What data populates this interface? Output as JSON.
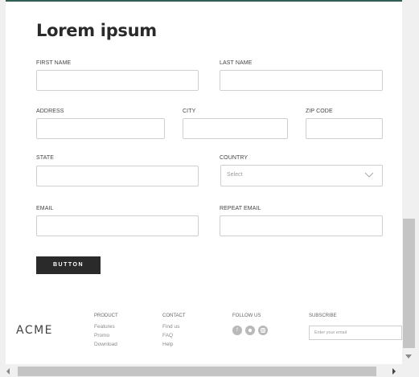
{
  "page": {
    "title": "Lorem ipsum"
  },
  "form": {
    "first_name_label": "FIRST NAME",
    "last_name_label": "LAST NAME",
    "address_label": "ADDRESS",
    "city_label": "CITY",
    "zip_label": "ZIP CODE",
    "state_label": "STATE",
    "country_label": "COUNTRY",
    "country_placeholder": "Select",
    "email_label": "EMAIL",
    "repeat_email_label": "REPEAT EMAIL",
    "submit_label": "BUTTON"
  },
  "footer": {
    "logo": "ACME",
    "product_heading": "PRODUCT",
    "product_links": [
      "Features",
      "Promo",
      "Download"
    ],
    "contact_heading": "CONTACT",
    "contact_links": [
      "Find us",
      "FAQ",
      "Help"
    ],
    "follow_heading": "FOLLOW US",
    "social_icons": [
      "facebook-icon",
      "twitter-icon",
      "instagram-icon"
    ],
    "subscribe_heading": "SUBSCRIBE",
    "subscribe_placeholder": "Enter your email"
  },
  "colors": {
    "accent": "#2f5f54",
    "button": "#2a2a2a",
    "border": "#cfcfcf"
  }
}
